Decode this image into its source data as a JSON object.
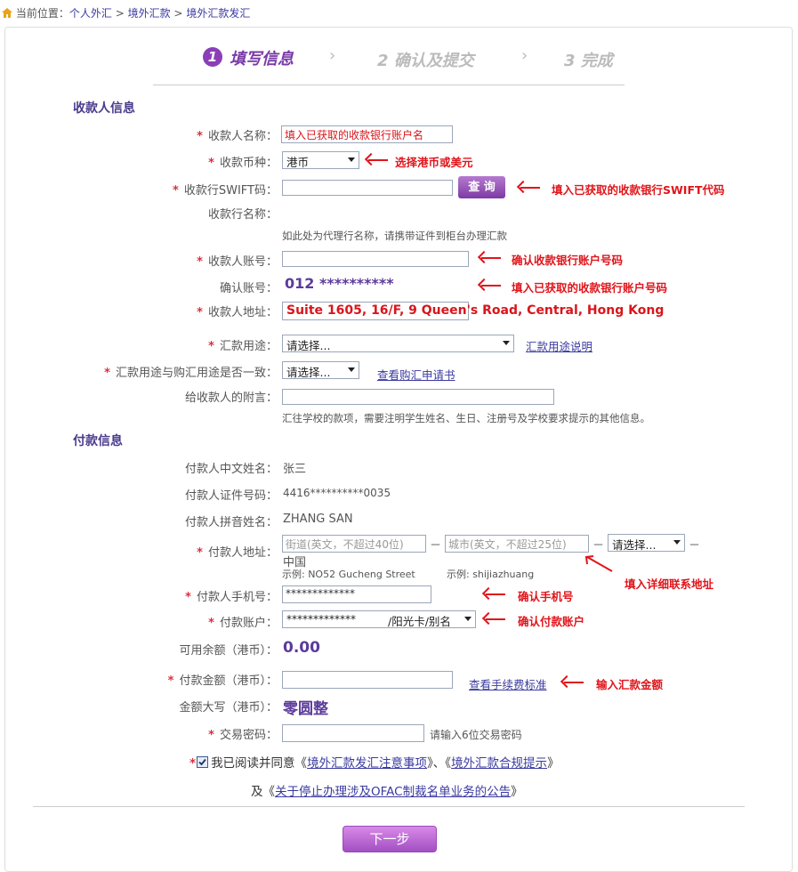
{
  "breadcrumb": {
    "label": "当前位置：",
    "items": [
      "个人外汇",
      "境外汇款",
      "境外汇款发汇"
    ],
    "sep": ">"
  },
  "steps": [
    {
      "num": "1",
      "label": "填写信息",
      "active": true
    },
    {
      "num": "2",
      "label": "确认及提交",
      "active": false
    },
    {
      "num": "3",
      "label": "完成",
      "active": false
    }
  ],
  "payee_section": {
    "title": "收款人信息",
    "name_label": "收款人名称：",
    "name_value": "填入已获取的收款银行账户名",
    "currency_label": "收款币种：",
    "currency_value": "港币",
    "currency_note": "选择港币或美元",
    "swift_label": "收款行SWIFT码：",
    "swift_button": "查 询",
    "swift_note": "填入已获取的收款银行SWIFT代码",
    "bank_name_label": "收款行名称：",
    "bank_hint": "如此处为代理行名称，请携带证件到柜台办理汇款",
    "account_label": "收款人账号：",
    "account_note": "确认收款银行账户号码",
    "confirm_label": "确认账号：",
    "confirm_value": "012 **********",
    "confirm_note": "填入已获取的收款银行账户号码",
    "address_label": "收款人地址：",
    "address_value": "Suite 1605, 16/F, 9 Queen's Road, Central, Hong Kong",
    "purpose_label": "汇款用途：",
    "purpose_value": "请选择...",
    "purpose_link": "汇款用途说明",
    "consistent_label": "汇款用途与购汇用途是否一致：",
    "consistent_value": "请选择...",
    "consistent_link": "查看购汇申请书",
    "message_label": "给收款人的附言：",
    "message_hint": "汇往学校的款项，需要注明学生姓名、生日、注册号及学校要求提示的其他信息。"
  },
  "payer_section": {
    "title": "付款信息",
    "cn_name_label": "付款人中文姓名：",
    "cn_name_value": "张三",
    "id_label": "付款人证件号码：",
    "id_value": "4416**********0035",
    "pinyin_label": "付款人拼音姓名：",
    "pinyin_value": "ZHANG SAN",
    "address_label": "付款人地址：",
    "street_placeholder": "街道(英文，不超过40位)",
    "city_placeholder": "城市(英文，不超过25位)",
    "province_value": "请选择...",
    "dash": "－",
    "country": "中国",
    "street_example": "示例: NO52 Gucheng Street",
    "city_example": "示例: shijiazhuang",
    "address_note": "填入详细联系地址",
    "phone_label": "付款人手机号：",
    "phone_value": "*************",
    "phone_note": "确认手机号",
    "account_label": "付款账户：",
    "account_value": "*************",
    "account_suffix": "/阳光卡/别名",
    "account_note": "确认付款账户",
    "balance_label": "可用余额（港币）：",
    "balance_value": "0.00",
    "amount_label": "付款金额（港币）：",
    "fee_link": "查看手续费标准",
    "amount_note": "输入汇款金额",
    "uppercase_label": "金额大写（港币）：",
    "uppercase_value": "零圆整",
    "password_label": "交易密码：",
    "password_hint": "请输入6位交易密码"
  },
  "agreement": {
    "prefix": "我已阅读并同意《",
    "link1": "境外汇款发汇注意事项",
    "mid": "》、《",
    "link2": "境外汇款合规提示",
    "suffix": "》",
    "line2_prefix": "及《",
    "link3": "关于停止办理涉及OFAC制裁名单业务的公告",
    "line2_suffix": "》"
  },
  "next_button": "下一步",
  "colors": {
    "accent": "#8a3fb8",
    "annotation": "#e0151b",
    "section": "#4a3b8c"
  }
}
